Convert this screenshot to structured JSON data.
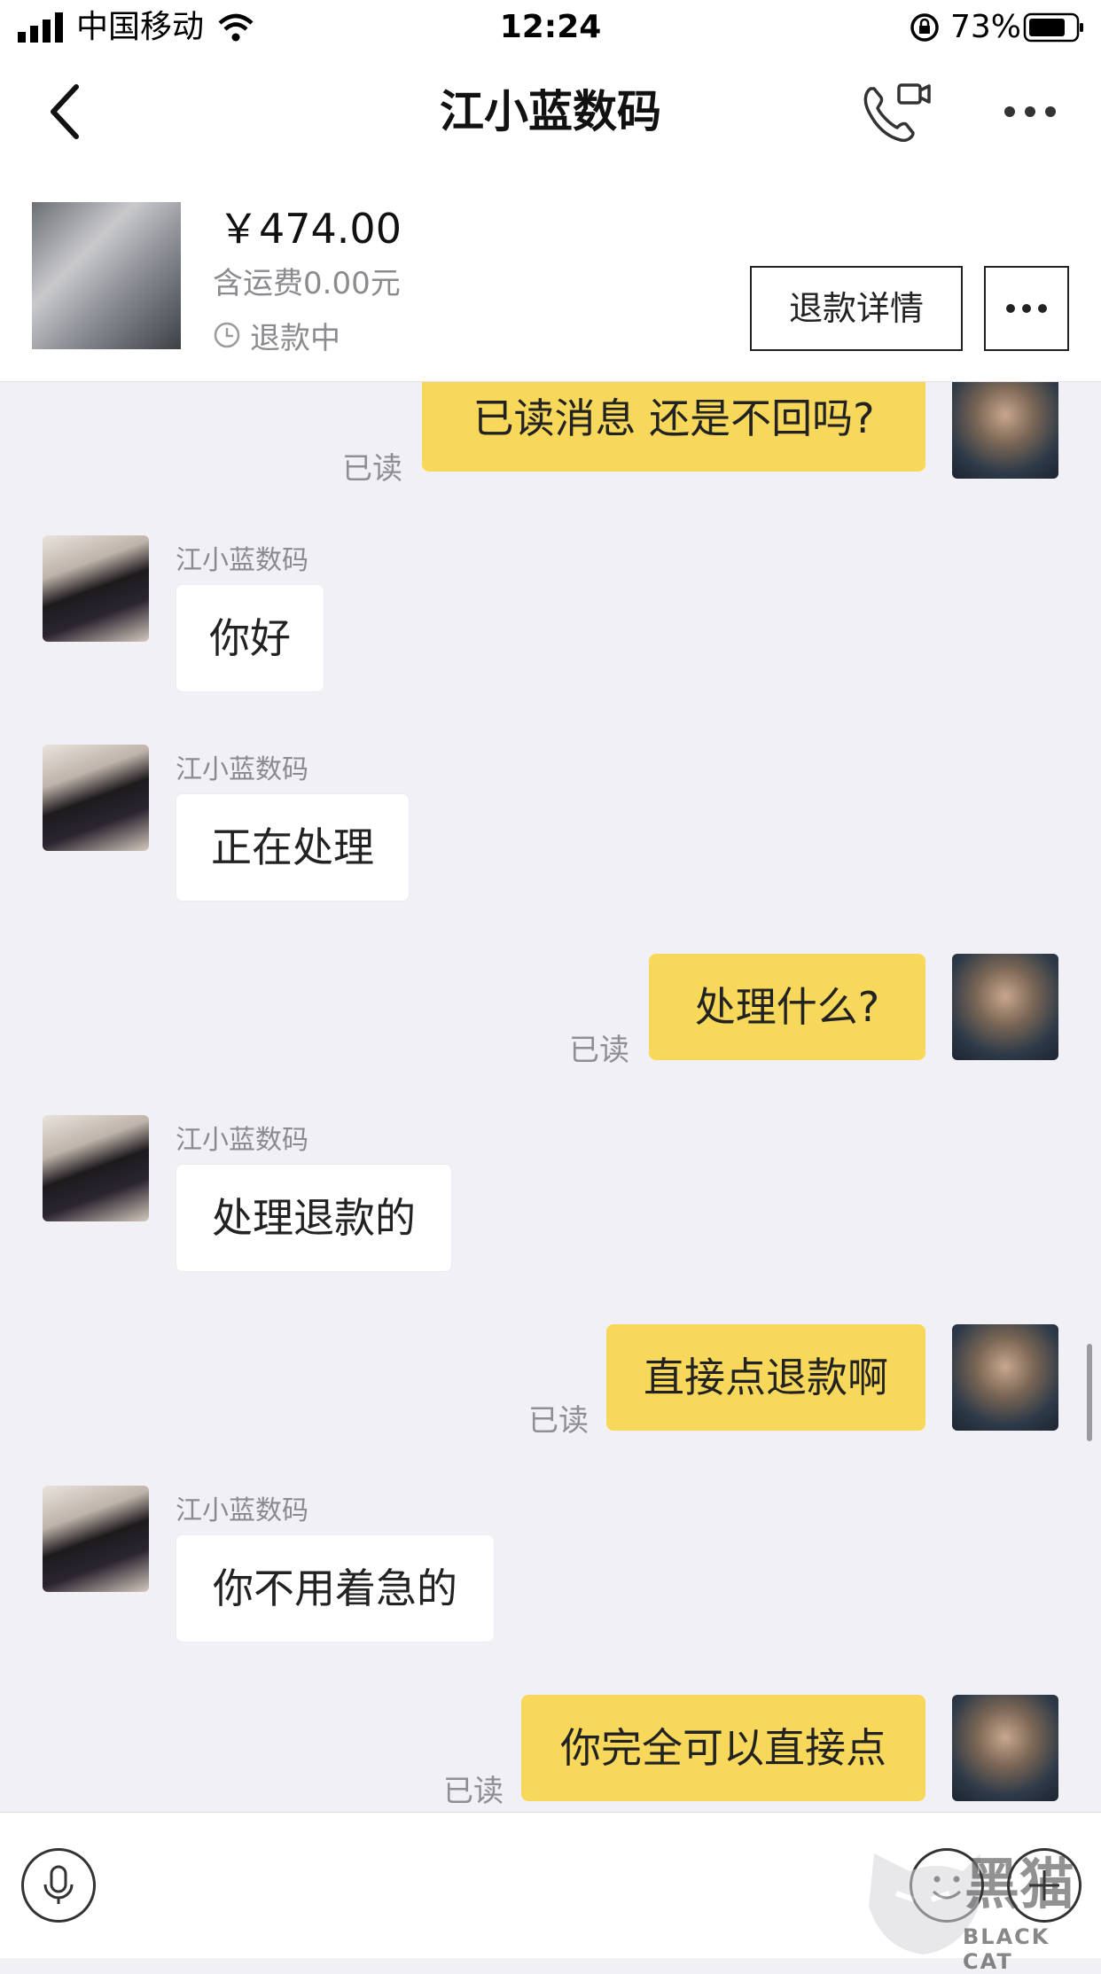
{
  "status_bar": {
    "carrier": "中国移动",
    "time": "12:24",
    "battery": "73%"
  },
  "nav": {
    "title": "江小蓝数码"
  },
  "product": {
    "price": "￥474.00",
    "shipping": "含运费0.00元",
    "status": "退款中",
    "refund_button": "退款详情"
  },
  "messages": [
    {
      "from": "me",
      "text": "已读消息  还是不回吗?",
      "read": "已读"
    },
    {
      "from": "shop",
      "sender": "江小蓝数码",
      "text": "你好"
    },
    {
      "from": "shop",
      "sender": "江小蓝数码",
      "text": "正在处理"
    },
    {
      "from": "me",
      "text": "处理什么?",
      "read": "已读"
    },
    {
      "from": "shop",
      "sender": "江小蓝数码",
      "text": "处理退款的"
    },
    {
      "from": "me",
      "text": "直接点退款啊",
      "read": "已读"
    },
    {
      "from": "shop",
      "sender": "江小蓝数码",
      "text": "你不用着急的"
    },
    {
      "from": "me",
      "text": "你完全可以直接点",
      "read": "已读"
    }
  ],
  "watermark": {
    "cn": "黑猫",
    "en": "BLACK CAT"
  }
}
